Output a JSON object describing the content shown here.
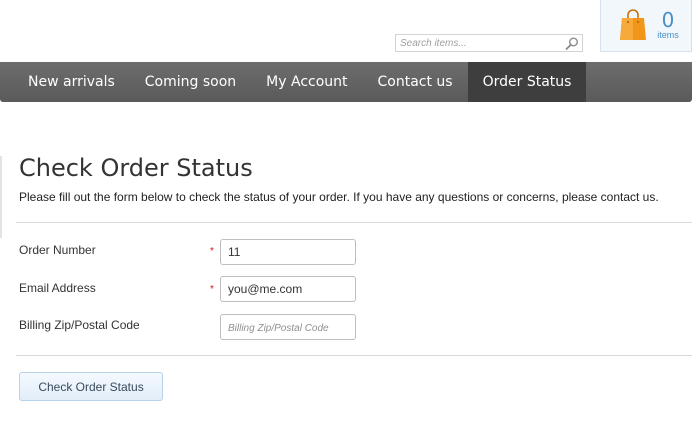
{
  "header": {
    "search": {
      "placeholder": "Search items...",
      "icon": "magnifier-icon"
    },
    "cart": {
      "icon": "shopping-bag-icon",
      "count": "0",
      "items_label": "items",
      "bag_color": "#f0961a"
    }
  },
  "nav": {
    "items": [
      {
        "label": "New arrivals"
      },
      {
        "label": "Coming soon"
      },
      {
        "label": "My Account"
      },
      {
        "label": "Contact us"
      },
      {
        "label": "Order Status",
        "active": true
      }
    ]
  },
  "main": {
    "title": "Check Order Status",
    "intro": "Please fill out the form below to check the status of your order. If you have any questions or concerns, please contact us.",
    "form": {
      "fields": [
        {
          "label": "Order Number",
          "required": true,
          "value": "11",
          "placeholder": ""
        },
        {
          "label": "Email Address",
          "required": true,
          "value": "you@me.com",
          "placeholder": ""
        },
        {
          "label": "Billing Zip/Postal Code",
          "required": false,
          "value": "",
          "placeholder": "Billing Zip/Postal Code"
        }
      ],
      "required_mark": "*",
      "submit_label": "Check Order Status"
    }
  },
  "colors": {
    "nav_bg": "#646464",
    "nav_active_bg": "#3e3e3e",
    "required": "#d01717",
    "accent_blue": "#4a90c8"
  }
}
